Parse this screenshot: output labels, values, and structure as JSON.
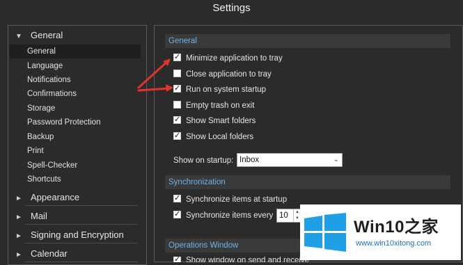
{
  "window": {
    "title": "Settings"
  },
  "sidebar": {
    "groups": [
      {
        "label": "General",
        "expanded": true
      },
      {
        "label": "Appearance",
        "expanded": false
      },
      {
        "label": "Mail",
        "expanded": false
      },
      {
        "label": "Signing and Encryption",
        "expanded": false
      },
      {
        "label": "Calendar",
        "expanded": false
      }
    ],
    "items": [
      {
        "label": "General",
        "active": true
      },
      {
        "label": "Language"
      },
      {
        "label": "Notifications"
      },
      {
        "label": "Confirmations"
      },
      {
        "label": "Storage"
      },
      {
        "label": "Password Protection"
      },
      {
        "label": "Backup"
      },
      {
        "label": "Print"
      },
      {
        "label": "Spell-Checker"
      },
      {
        "label": "Shortcuts"
      }
    ]
  },
  "main": {
    "general": {
      "header": "General",
      "options": [
        {
          "label": "Minimize application to tray",
          "checked": true
        },
        {
          "label": "Close application to tray",
          "checked": false
        },
        {
          "label": "Run on system startup",
          "checked": true
        },
        {
          "label": "Empty trash on exit",
          "checked": false
        },
        {
          "label": "Show Smart folders",
          "checked": true
        },
        {
          "label": "Show Local folders",
          "checked": true
        }
      ],
      "startup_label": "Show on startup:",
      "startup_value": "Inbox"
    },
    "sync": {
      "header": "Synchronization",
      "at_startup": {
        "label": "Synchronize items at startup",
        "checked": true
      },
      "every": {
        "label": "Synchronize items every",
        "checked": true,
        "value": "10"
      }
    },
    "operations": {
      "header": "Operations Window",
      "partial_option": "Show window on send and receive"
    }
  },
  "watermark": {
    "title_main": "Win10",
    "title_accent": "之家",
    "url": "www.win10xitong.com"
  },
  "colors": {
    "background": "#2b2b2b",
    "section_text": "#6fb3e8",
    "arrow": "#e0342c"
  }
}
